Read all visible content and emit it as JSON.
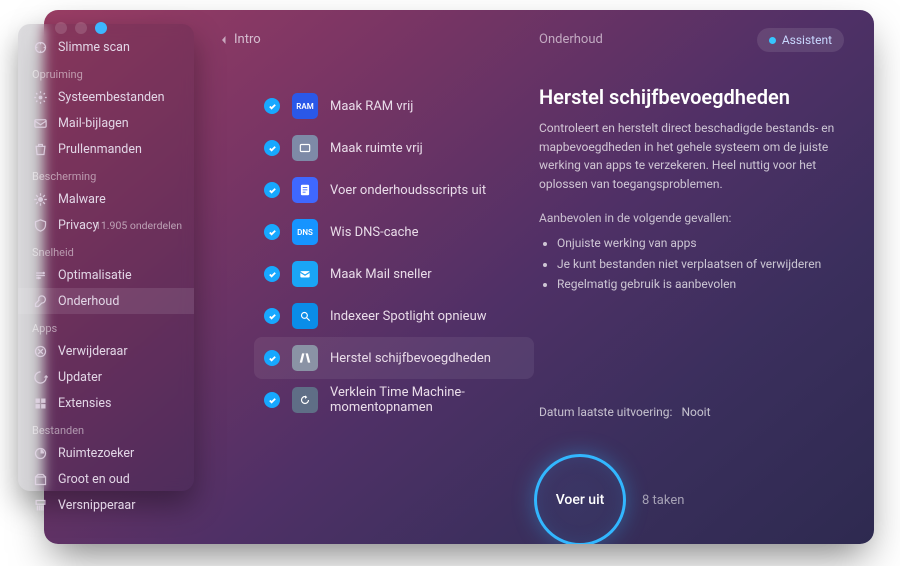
{
  "header": {
    "back_label": "Intro",
    "breadcrumb": "Onderhoud",
    "assistant_label": "Assistent"
  },
  "sidebar": {
    "top_item": "Slimme scan",
    "sections": [
      {
        "title": "Opruiming",
        "items": [
          {
            "label": "Systeembestanden"
          },
          {
            "label": "Mail-bijlagen"
          },
          {
            "label": "Prullenmanden"
          }
        ]
      },
      {
        "title": "Bescherming",
        "items": [
          {
            "label": "Malware"
          },
          {
            "label": "Privacy",
            "count": "11.905 onderdelen"
          }
        ]
      },
      {
        "title": "Snelheid",
        "items": [
          {
            "label": "Optimalisatie"
          },
          {
            "label": "Onderhoud",
            "selected": true
          }
        ]
      },
      {
        "title": "Apps",
        "items": [
          {
            "label": "Verwijderaar"
          },
          {
            "label": "Updater"
          },
          {
            "label": "Extensies"
          }
        ]
      },
      {
        "title": "Bestanden",
        "items": [
          {
            "label": "Ruimtezoeker"
          },
          {
            "label": "Groot en oud"
          },
          {
            "label": "Versnipperaar"
          }
        ]
      }
    ]
  },
  "tasks": [
    {
      "label": "Maak RAM vrij"
    },
    {
      "label": "Maak ruimte vrij"
    },
    {
      "label": "Voer onderhoudsscripts uit"
    },
    {
      "label": "Wis DNS-cache"
    },
    {
      "label": "Maak Mail sneller"
    },
    {
      "label": "Indexeer Spotlight opnieuw"
    },
    {
      "label": "Herstel schijfbevoegdheden",
      "selected": true
    },
    {
      "label": "Verklein Time Machine-momentopnamen"
    }
  ],
  "detail": {
    "title": "Herstel schijfbevoegdheden",
    "desc": "Controleert en herstelt direct beschadigde bestands- en mapbevoegdheden in het gehele systeem om de juiste werking van apps te verzekeren. Heel nuttig voor het oplossen van toegangsproblemen.",
    "recommend_label": "Aanbevolen in de volgende gevallen:",
    "bullets": [
      "Onjuiste werking van apps",
      "Je kunt bestanden niet verplaatsen of verwijderen",
      "Regelmatig gebruik is aanbevolen"
    ]
  },
  "lastrun": {
    "label": "Datum laatste uitvoering:",
    "value": "Nooit"
  },
  "run": {
    "button": "Voer uit",
    "count": "8 taken"
  }
}
